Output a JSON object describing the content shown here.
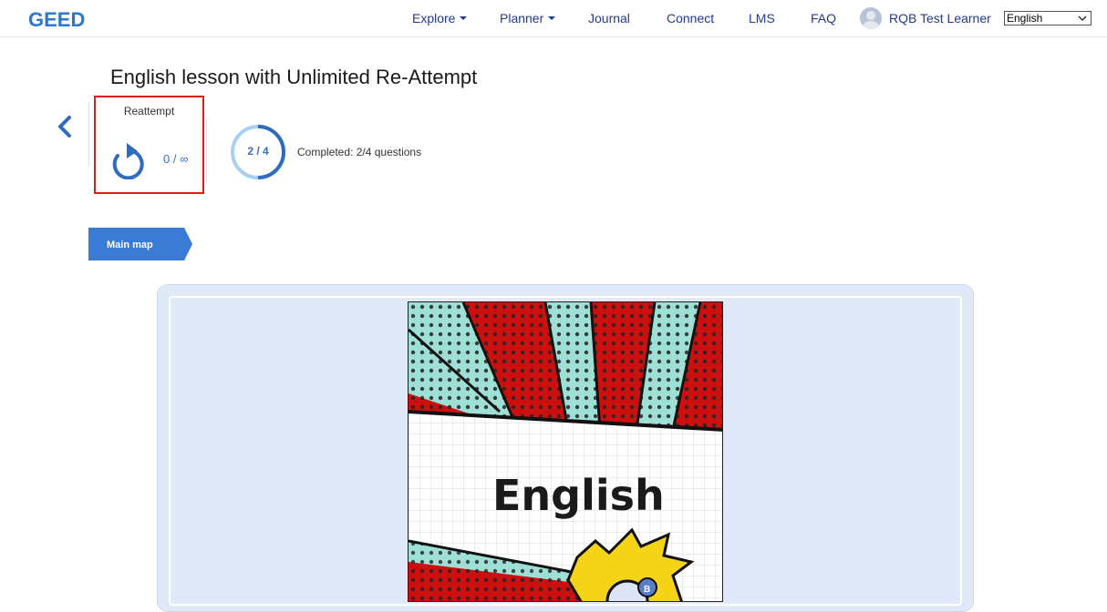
{
  "header": {
    "logo_text": "GEED",
    "nav": [
      {
        "label": "Explore",
        "dropdown": true
      },
      {
        "label": "Planner",
        "dropdown": true
      },
      {
        "label": "Journal",
        "dropdown": false
      },
      {
        "label": "Connect",
        "dropdown": false
      },
      {
        "label": "LMS",
        "dropdown": false
      },
      {
        "label": "FAQ",
        "dropdown": false
      }
    ],
    "user_name": "RQB Test Learner",
    "language": "English"
  },
  "lesson": {
    "title": "English lesson with Unlimited Re-Attempt",
    "reattempt_label": "Reattempt",
    "reattempt_count": "0 / ∞",
    "progress_label": "2 / 4",
    "progress_fraction": 0.5,
    "completed_text": "Completed: 2/4 questions",
    "main_map_label": "Main map"
  },
  "cover": {
    "title": "English"
  },
  "colors": {
    "nav_text": "#243a8c",
    "accent_blue": "#3a7bd5",
    "highlight_red": "#e01919",
    "panel_bg": "#dfe9f7"
  },
  "icons": [
    "logo-icon",
    "back-chevron-icon",
    "reattempt-icon",
    "chevron-down-icon",
    "avatar-icon"
  ]
}
